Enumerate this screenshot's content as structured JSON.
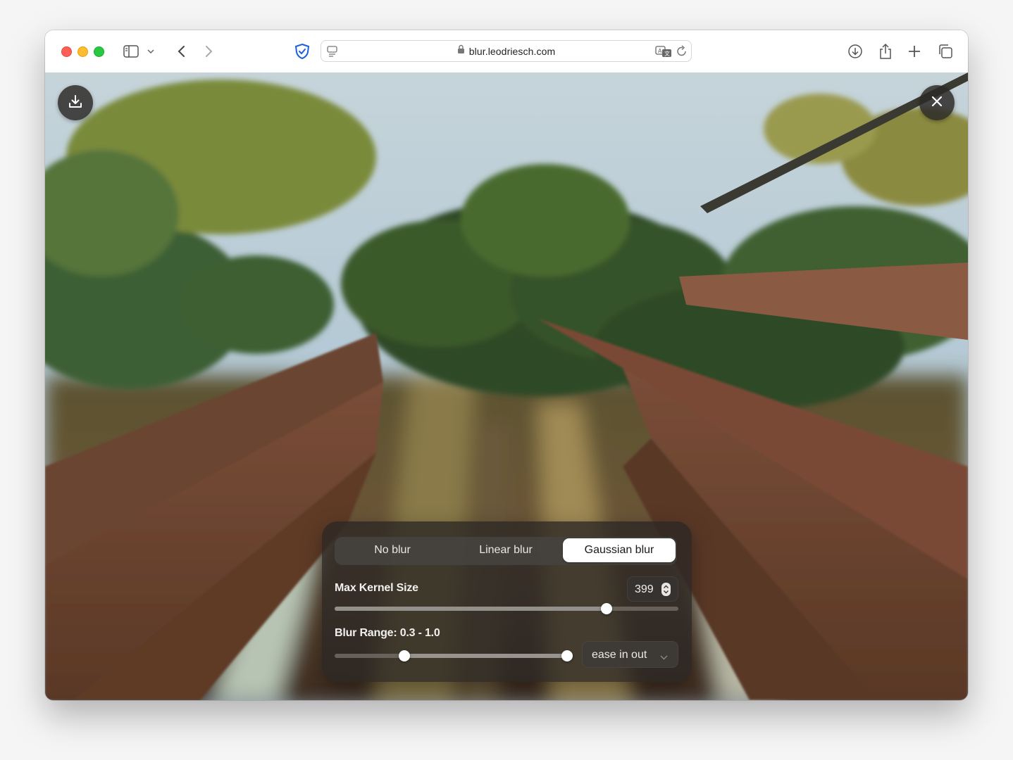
{
  "browser": {
    "url": "blur.leodriesch.com",
    "icons": [
      "sidebar-icon",
      "chevron-down-icon",
      "back-icon",
      "forward-icon",
      "shield-icon",
      "page-icon",
      "lock-icon",
      "translate-icon",
      "reload-icon",
      "download-icon",
      "share-icon",
      "new-tab-icon",
      "tabs-overview-icon"
    ]
  },
  "page": {
    "image_description_icons": [
      "download-icon",
      "close-icon"
    ],
    "blur_modes": [
      {
        "label": "No blur",
        "selected": false
      },
      {
        "label": "Linear blur",
        "selected": false
      },
      {
        "label": "Gaussian blur",
        "selected": true
      }
    ],
    "kernel": {
      "label": "Max Kernel Size",
      "value": "399",
      "slider_fraction": 0.79
    },
    "range": {
      "label": "Blur Range: 0.3 - 1.0",
      "low": 0.3,
      "high": 1.0,
      "easing": "ease in out"
    }
  },
  "colors": {
    "accent_shield": "#1a5fe0",
    "panel_bg": "#2a2624",
    "selected_segment": "#ffffff"
  }
}
